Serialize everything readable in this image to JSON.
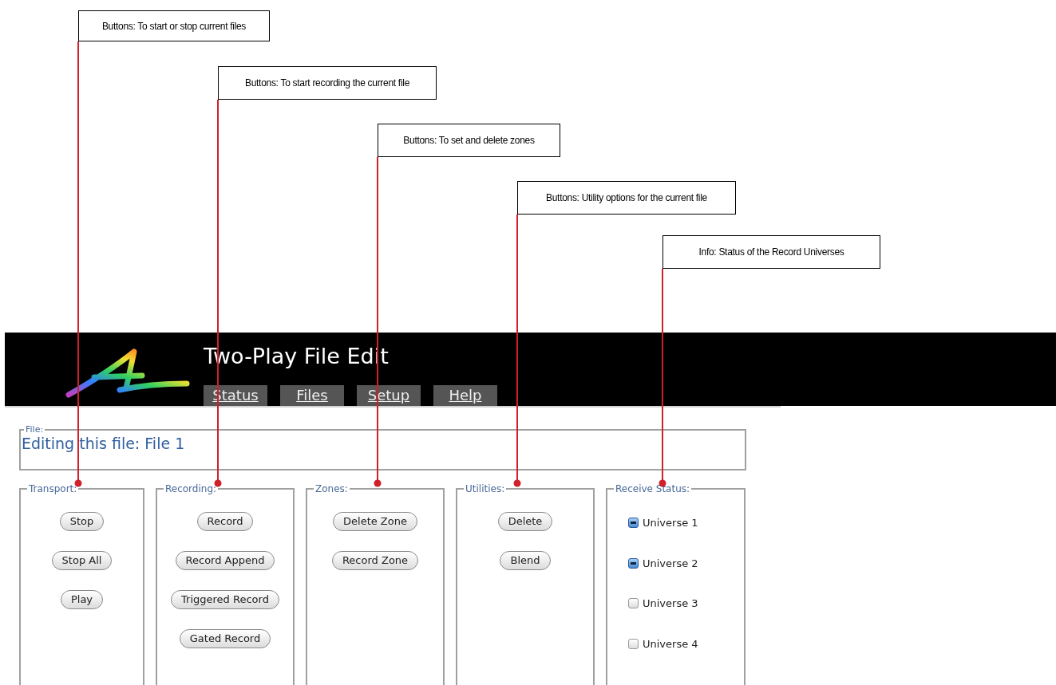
{
  "callouts": [
    {
      "text": "Buttons: To start or stop current files"
    },
    {
      "text": "Buttons: To start recording the current file"
    },
    {
      "text": "Buttons: To set and delete zones"
    },
    {
      "text": "Buttons: Utility options for the current file"
    },
    {
      "text": "Info: Status of the Record Universes"
    }
  ],
  "header": {
    "title": "Two-Play File Edit",
    "tabs": [
      {
        "label": "Status"
      },
      {
        "label": "Files"
      },
      {
        "label": "Setup"
      },
      {
        "label": "Help"
      }
    ]
  },
  "file": {
    "legend": "File:",
    "heading": "Editing this file: File 1"
  },
  "panels": [
    {
      "legend": "Transport:",
      "kind": "buttons",
      "buttons": [
        "Stop",
        "Stop All",
        "Play"
      ]
    },
    {
      "legend": "Recording:",
      "kind": "buttons",
      "buttons": [
        "Record",
        "Record Append",
        "Triggered Record",
        "Gated Record"
      ]
    },
    {
      "legend": "Zones:",
      "kind": "buttons",
      "buttons": [
        "Delete Zone",
        "Record Zone"
      ]
    },
    {
      "legend": "Utilities:",
      "kind": "buttons",
      "buttons": [
        "Delete",
        "Blend"
      ]
    },
    {
      "legend": "Receive Status:",
      "kind": "checkboxes",
      "items": [
        {
          "label": "Universe 1",
          "checked": true
        },
        {
          "label": "Universe 2",
          "checked": true
        },
        {
          "label": "Universe 3",
          "checked": false
        },
        {
          "label": "Universe 4",
          "checked": false
        }
      ]
    }
  ]
}
